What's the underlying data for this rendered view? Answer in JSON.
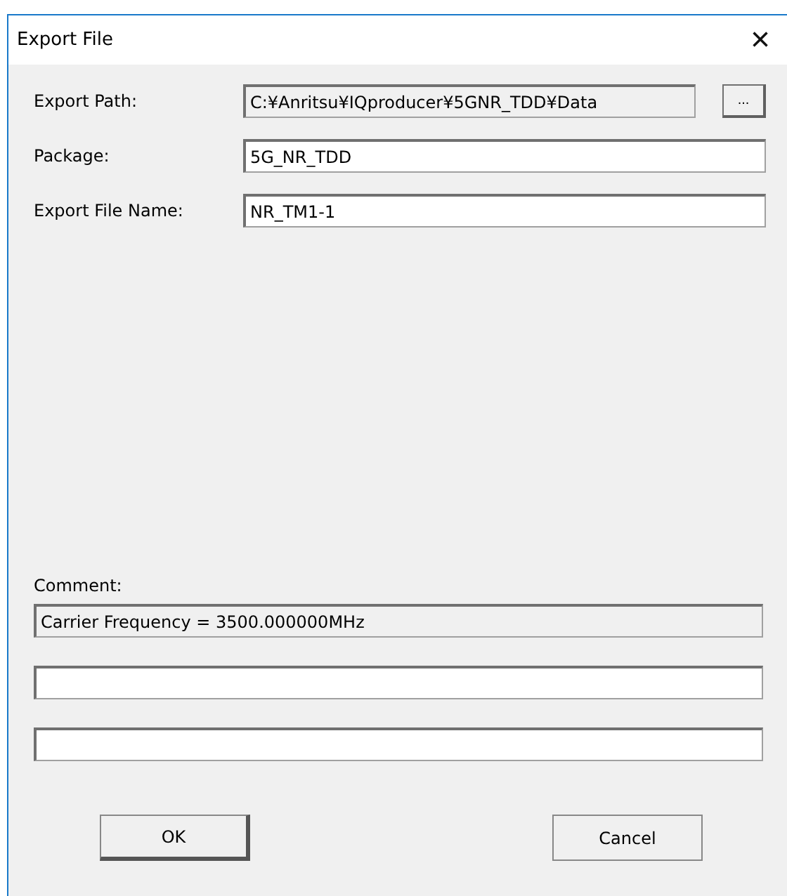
{
  "window": {
    "title": "Export File",
    "close": "×"
  },
  "fields": [
    {
      "label": "Export Path:",
      "value": "C:¥Anritsu¥IQproducer¥5GNR_TDD¥Data",
      "disabled": true,
      "browse": "..."
    },
    {
      "label": "Package:",
      "value": "5G_NR_TDD",
      "disabled": false
    },
    {
      "label": "Export File Name:",
      "value": "NR_TM1-1",
      "disabled": false
    }
  ],
  "comment": {
    "label": "Comment:",
    "lines": [
      {
        "value": "Carrier Frequency = 3500.000000MHz",
        "disabled": true
      },
      {
        "disabled": false
      },
      {
        "disabled": false
      }
    ]
  },
  "buttons": [
    {
      "label": "OK",
      "default": true
    },
    {
      "label": "Cancel",
      "default": false
    }
  ]
}
